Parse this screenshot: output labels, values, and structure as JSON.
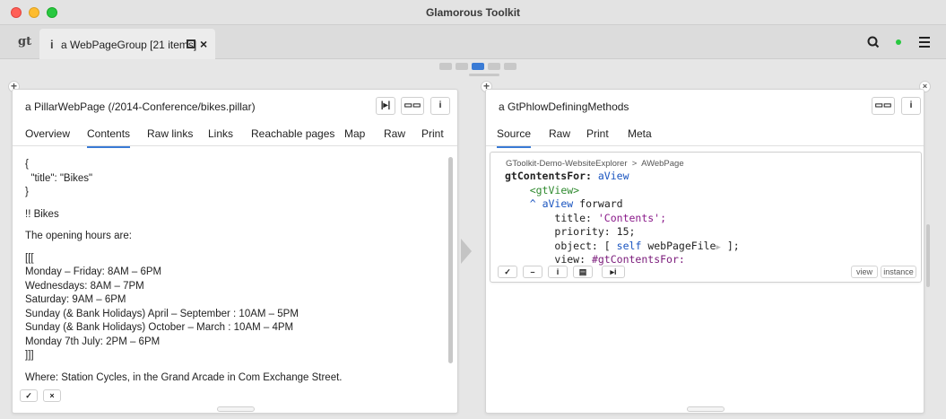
{
  "window": {
    "title": "Glamorous Toolkit"
  },
  "tabbar": {
    "logo": "gt",
    "tab_icon": "i",
    "tab_label": "a WebPageGroup [21 items]",
    "close_glyph": "×"
  },
  "left_pane": {
    "title": "a PillarWebPage (/2014-Conference/bikes.pillar)",
    "buttons": [
      "|▸|",
      "▭▭",
      "i"
    ],
    "tabs": [
      "Overview",
      "Contents",
      "Raw links",
      "Links",
      "Reachable pages",
      "Map",
      "Raw",
      "Print"
    ],
    "selected_tab": "Contents",
    "lines": [
      "{",
      "  \"title\": \"Bikes\"",
      "}",
      "",
      "!! Bikes",
      "",
      "The opening hours are:",
      "",
      "[[[",
      "Monday – Friday: 8AM – 6PM",
      "Wednesdays: 8AM – 7PM",
      "Saturday: 9AM – 6PM",
      "Sunday (& Bank Holidays) April – September : 10AM – 5PM",
      "Sunday (& Bank Holidays) October – March : 10AM – 4PM",
      "Monday 7th July: 2PM – 6PM",
      "]]]",
      "",
      "Where: Station Cycles, in the Grand Arcade in Com Exchange Street."
    ],
    "accept_label": "✓",
    "cancel_label": "×"
  },
  "right_pane": {
    "title": "a GtPhlowDefiningMethods",
    "buttons": [
      "▭▭",
      "i"
    ],
    "tabs": [
      "Source",
      "Raw",
      "Print",
      "Meta"
    ],
    "selected_tab": "Source",
    "breadcrumb": "GToolkit-Demo-WebsiteExplorer  >  AWebPage",
    "code": {
      "selector": "gtContentsFor:",
      "arg": "aView",
      "pragma": "<gtView>",
      "return": "^",
      "receiver": "aView",
      "msg_forward": "forward",
      "kw_title": "title:",
      "str_title": "'Contents';",
      "kw_priority": "priority:",
      "num_priority": "15;",
      "kw_object": "object:",
      "open_block": "[",
      "self_kw": "self",
      "msg_file": "webPageFile",
      "close_block": "];",
      "kw_view": "view:",
      "sym_view": "#gtContentsFor:"
    },
    "code_buttons": [
      "✓",
      "–",
      "i",
      "▤",
      "▸i"
    ],
    "code_tags": [
      "view",
      "instance"
    ]
  }
}
